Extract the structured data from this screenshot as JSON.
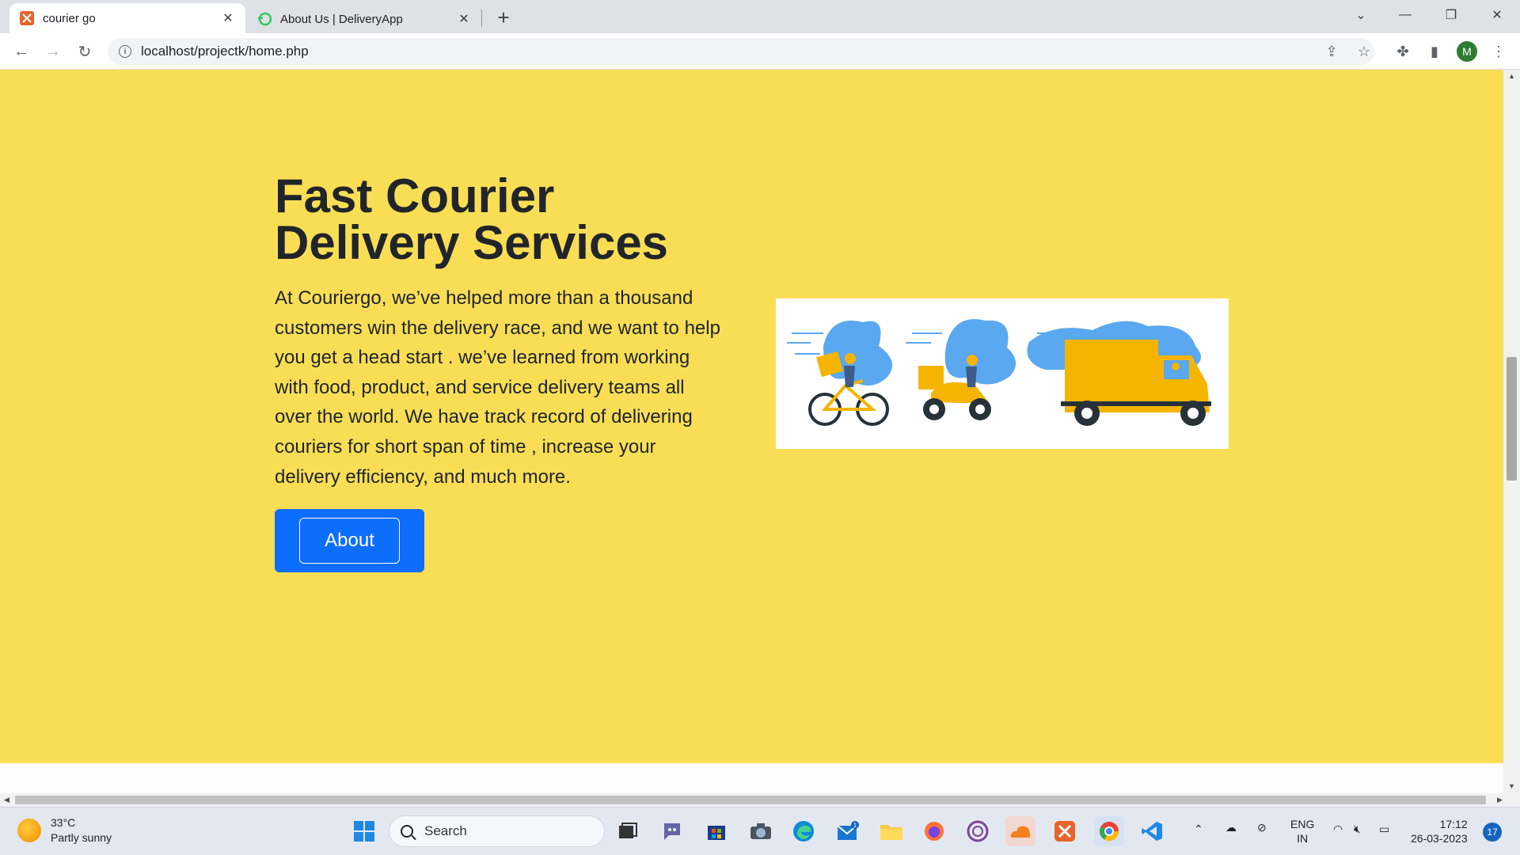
{
  "browser": {
    "tabs": [
      {
        "title": "courier go",
        "close": "✕"
      },
      {
        "title": "About Us | DeliveryApp",
        "close": "✕"
      }
    ],
    "new_tab": "+",
    "url": "localhost/projectk/home.php",
    "profile_initial": "M"
  },
  "hero": {
    "heading_line1": "Fast Courier",
    "heading_line2": "Delivery Services",
    "description": "At Couriergo, we’ve helped more than a thousand customers win the delivery race, and we want to help you get a head start . we’ve learned from working with food, product, and service delivery teams all over the world. We have track record of delivering couriers for short span of time , increase your delivery efficiency, and much more.",
    "about_button": "About",
    "image_icon": "delivery-vehicles-illustration",
    "background_color": "#f9de55",
    "button_color": "#0d6efd"
  },
  "taskbar": {
    "weather_temp": "33°C",
    "weather_desc": "Partly sunny",
    "search_label": "Search",
    "language_top": "ENG",
    "language_bottom": "IN",
    "time": "17:12",
    "date": "26-03-2023",
    "notification_count": "17",
    "mail_badge": "1"
  }
}
